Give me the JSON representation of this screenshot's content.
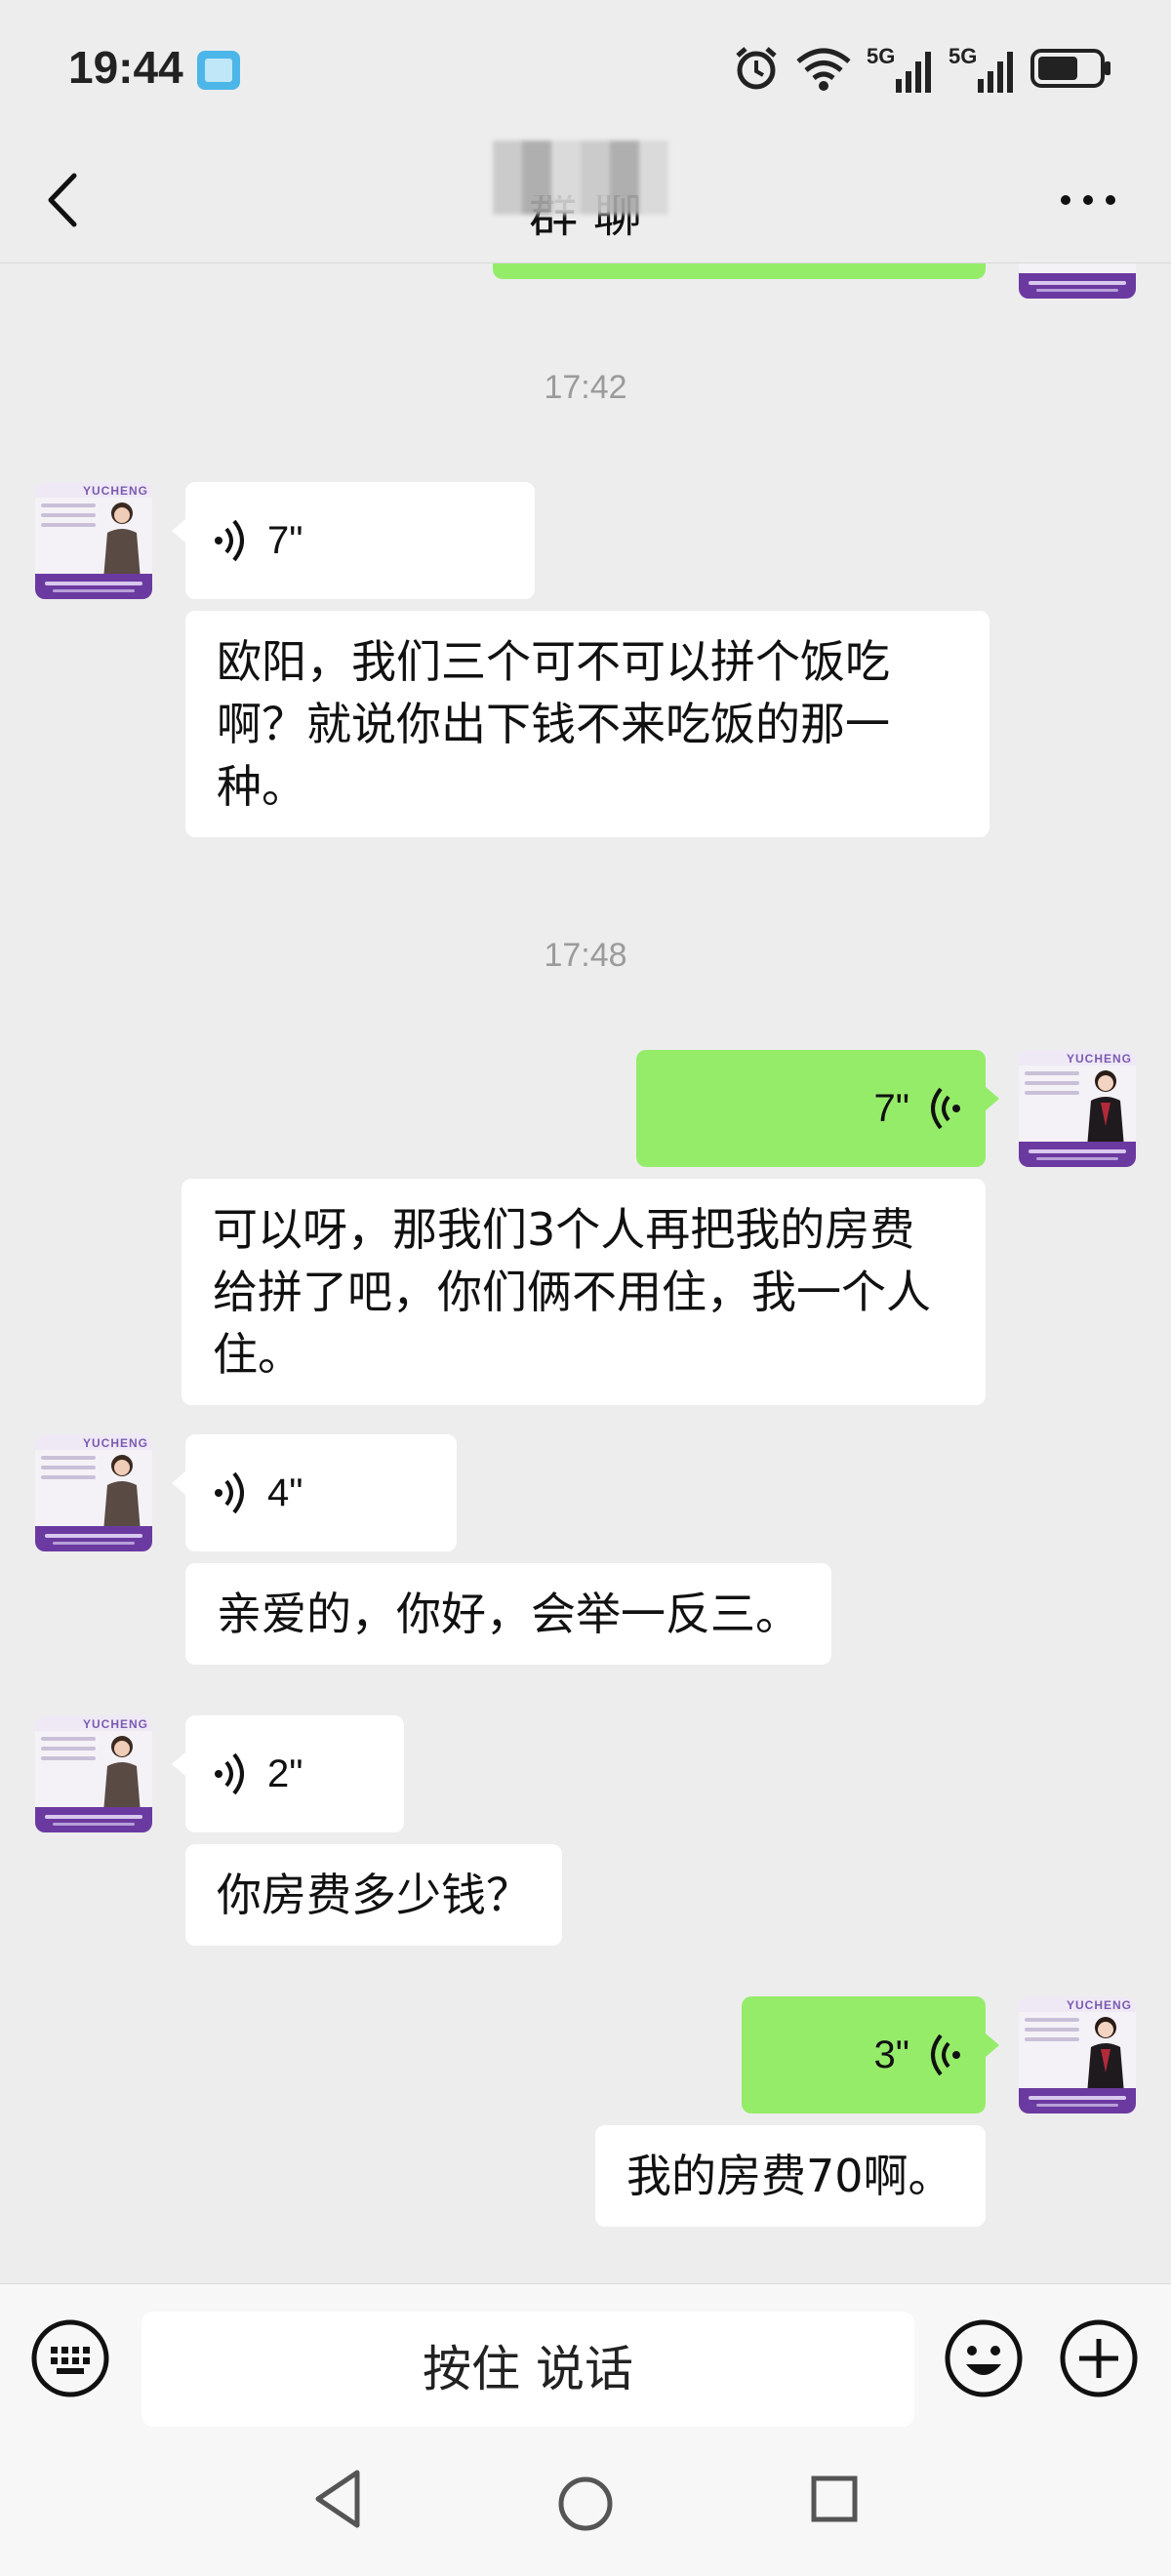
{
  "status_bar": {
    "time": "19:44",
    "icons": [
      "book-icon",
      "alarm-icon",
      "wifi-icon",
      "signal-5g-icon",
      "signal-5g-icon",
      "battery-icon"
    ],
    "network_labels": [
      "5G",
      "5G"
    ]
  },
  "header": {
    "title": "群 聊",
    "back_icon": "back-chevron-icon",
    "more_icon": "more-dots-icon"
  },
  "messages": [
    {
      "type": "timestamp",
      "text": "17:42"
    },
    {
      "type": "voice",
      "side": "in",
      "duration": "7\""
    },
    {
      "type": "text",
      "side": "in",
      "text": "欧阳，我们三个可不可以拼个饭吃啊？就说你出下钱不来吃饭的那一种。"
    },
    {
      "type": "timestamp",
      "text": "17:48"
    },
    {
      "type": "voice",
      "side": "out",
      "duration": "7\""
    },
    {
      "type": "text",
      "side": "in",
      "text": "可以呀，那我们3个人再把我的房费给拼了吧，你们俩不用住，我一个人住。"
    },
    {
      "type": "voice",
      "side": "in",
      "duration": "4\""
    },
    {
      "type": "text",
      "side": "in",
      "text": "亲爱的，你好，会举一反三。"
    },
    {
      "type": "voice",
      "side": "in",
      "duration": "2\""
    },
    {
      "type": "text",
      "side": "in",
      "text": "你房费多少钱？"
    },
    {
      "type": "voice",
      "side": "out",
      "duration": "3\""
    },
    {
      "type": "text",
      "side": "out",
      "text": "我的房费70啊。"
    }
  ],
  "avatar": {
    "brand": "YUCHENG"
  },
  "input_bar": {
    "talk_label": "按住 说话",
    "icons": [
      "keyboard-icon",
      "emoji-icon",
      "plus-icon"
    ]
  },
  "nav_bar": {
    "icons": [
      "nav-back-icon",
      "nav-home-icon",
      "nav-recent-icon"
    ]
  },
  "colors": {
    "background": "#ededed",
    "incoming_bubble": "#ffffff",
    "outgoing_bubble": "#95ec69",
    "timestamp": "#9b9b9b",
    "avatar_purple": "#6b3aa0"
  }
}
